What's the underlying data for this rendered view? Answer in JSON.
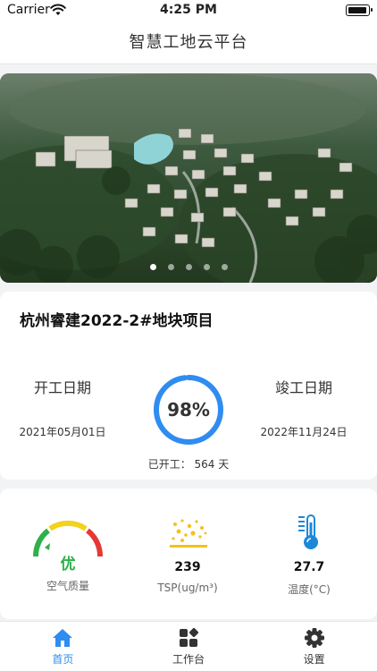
{
  "status_bar": {
    "carrier": "Carrier",
    "time": "4:25 PM"
  },
  "nav": {
    "title": "智慧工地云平台"
  },
  "banner": {
    "dots": 5,
    "active_index": 0
  },
  "project": {
    "name": "杭州睿建2022-2#地块项目",
    "start_label": "开工日期",
    "start_date": "2021年05月01日",
    "end_label": "竣工日期",
    "end_date": "2022年11月24日",
    "progress_text": "98%",
    "progress_value": 0.98,
    "elapsed_text": "已开工： 564 天"
  },
  "environment": {
    "air": {
      "grade": "优",
      "label": "空气质量"
    },
    "tsp": {
      "value": "239",
      "label": "TSP(ug/m³)"
    },
    "temperature": {
      "value": "27.7",
      "label": "温度(°C)"
    }
  },
  "tabs": [
    {
      "label": "首页",
      "active": true
    },
    {
      "label": "工作台",
      "active": false
    },
    {
      "label": "设置",
      "active": false
    }
  ],
  "colors": {
    "accent": "#2f8cf0",
    "good": "#2fb04a",
    "ring_track": "#e6eefb"
  }
}
